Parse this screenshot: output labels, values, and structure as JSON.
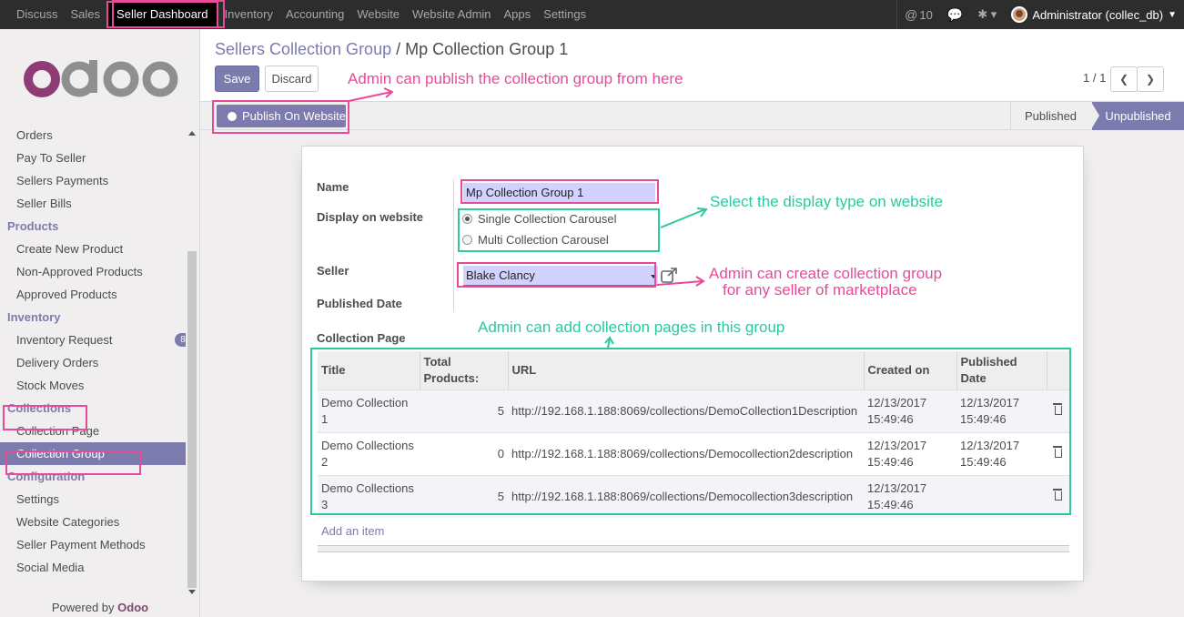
{
  "topbar": {
    "menu": [
      "Discuss",
      "Sales",
      "Seller Dashboard",
      "Inventory",
      "Accounting",
      "Website",
      "Website Admin",
      "Apps",
      "Settings"
    ],
    "active": "Seller Dashboard",
    "mentions": "10",
    "user": "Administrator (collec_db)"
  },
  "sidebar": {
    "items": [
      {
        "type": "item",
        "label": "Orders"
      },
      {
        "type": "item",
        "label": "Pay To Seller"
      },
      {
        "type": "item",
        "label": "Sellers Payments"
      },
      {
        "type": "item",
        "label": "Seller Bills"
      },
      {
        "type": "section",
        "label": "Products"
      },
      {
        "type": "item",
        "label": "Create New Product"
      },
      {
        "type": "item",
        "label": "Non-Approved Products"
      },
      {
        "type": "item",
        "label": "Approved Products"
      },
      {
        "type": "section",
        "label": "Inventory"
      },
      {
        "type": "item",
        "label": "Inventory Request",
        "badge": "8"
      },
      {
        "type": "item",
        "label": "Delivery Orders"
      },
      {
        "type": "item",
        "label": "Stock Moves"
      },
      {
        "type": "section",
        "label": "Collections"
      },
      {
        "type": "item",
        "label": "Collection Page"
      },
      {
        "type": "item",
        "label": "Collection Group",
        "active": true
      },
      {
        "type": "section",
        "label": "Configuration"
      },
      {
        "type": "item",
        "label": "Settings"
      },
      {
        "type": "item",
        "label": "Website Categories"
      },
      {
        "type": "item",
        "label": "Seller Payment Methods"
      },
      {
        "type": "item",
        "label": "Social Media"
      }
    ],
    "powered_by": "Powered by",
    "powered_brand": "Odoo"
  },
  "control": {
    "breadcrumb_parent": "Sellers Collection Group",
    "breadcrumb_sep": "/",
    "breadcrumb_current": "Mp Collection Group 1",
    "save_label": "Save",
    "discard_label": "Discard",
    "pager": "1 / 1"
  },
  "status": {
    "publish_label": "Publish On Website",
    "stages": [
      "Published",
      "Unpublished"
    ],
    "current": "Unpublished"
  },
  "form": {
    "name_label": "Name",
    "name_value": "Mp Collection Group 1",
    "display_label": "Display on website",
    "display_options": [
      "Single Collection Carousel",
      "Multi Collection Carousel"
    ],
    "display_selected": "Single Collection Carousel",
    "seller_label": "Seller",
    "seller_value": "Blake Clancy",
    "published_date_label": "Published Date",
    "collection_page_label": "Collection Page",
    "table": {
      "headers": [
        "Title",
        "Total Products:",
        "URL",
        "Created on",
        "Published Date"
      ],
      "rows": [
        {
          "title": "Demo Collection 1",
          "total": "5",
          "url": "http://192.168.1.188:8069/collections/DemoCollection1Description",
          "created": "12/13/2017 15:49:46",
          "published": "12/13/2017 15:49:46"
        },
        {
          "title": "Demo Collections 2",
          "total": "0",
          "url": "http://192.168.1.188:8069/collections/Democollection2description",
          "created": "12/13/2017 15:49:46",
          "published": "12/13/2017 15:49:46"
        },
        {
          "title": "Demo Collections 3",
          "total": "5",
          "url": "http://192.168.1.188:8069/collections/Democollection3description",
          "created": "12/13/2017 15:49:46",
          "published": ""
        }
      ]
    },
    "add_item": "Add an item"
  },
  "annotations": {
    "publish_note": "Admin can publish the collection group from here",
    "display_note": "Select the display type on website",
    "seller_note_1": "Admin can create collection group",
    "seller_note_2": "for any seller of marketplace",
    "pages_note": "Admin can add collection pages in this group",
    "pink": "#e94a98",
    "green": "#2cc8a0"
  },
  "colors": {
    "brand": "#7c7bad",
    "topbar": "#2d2d2d",
    "input_required": "#d2d2ff"
  }
}
